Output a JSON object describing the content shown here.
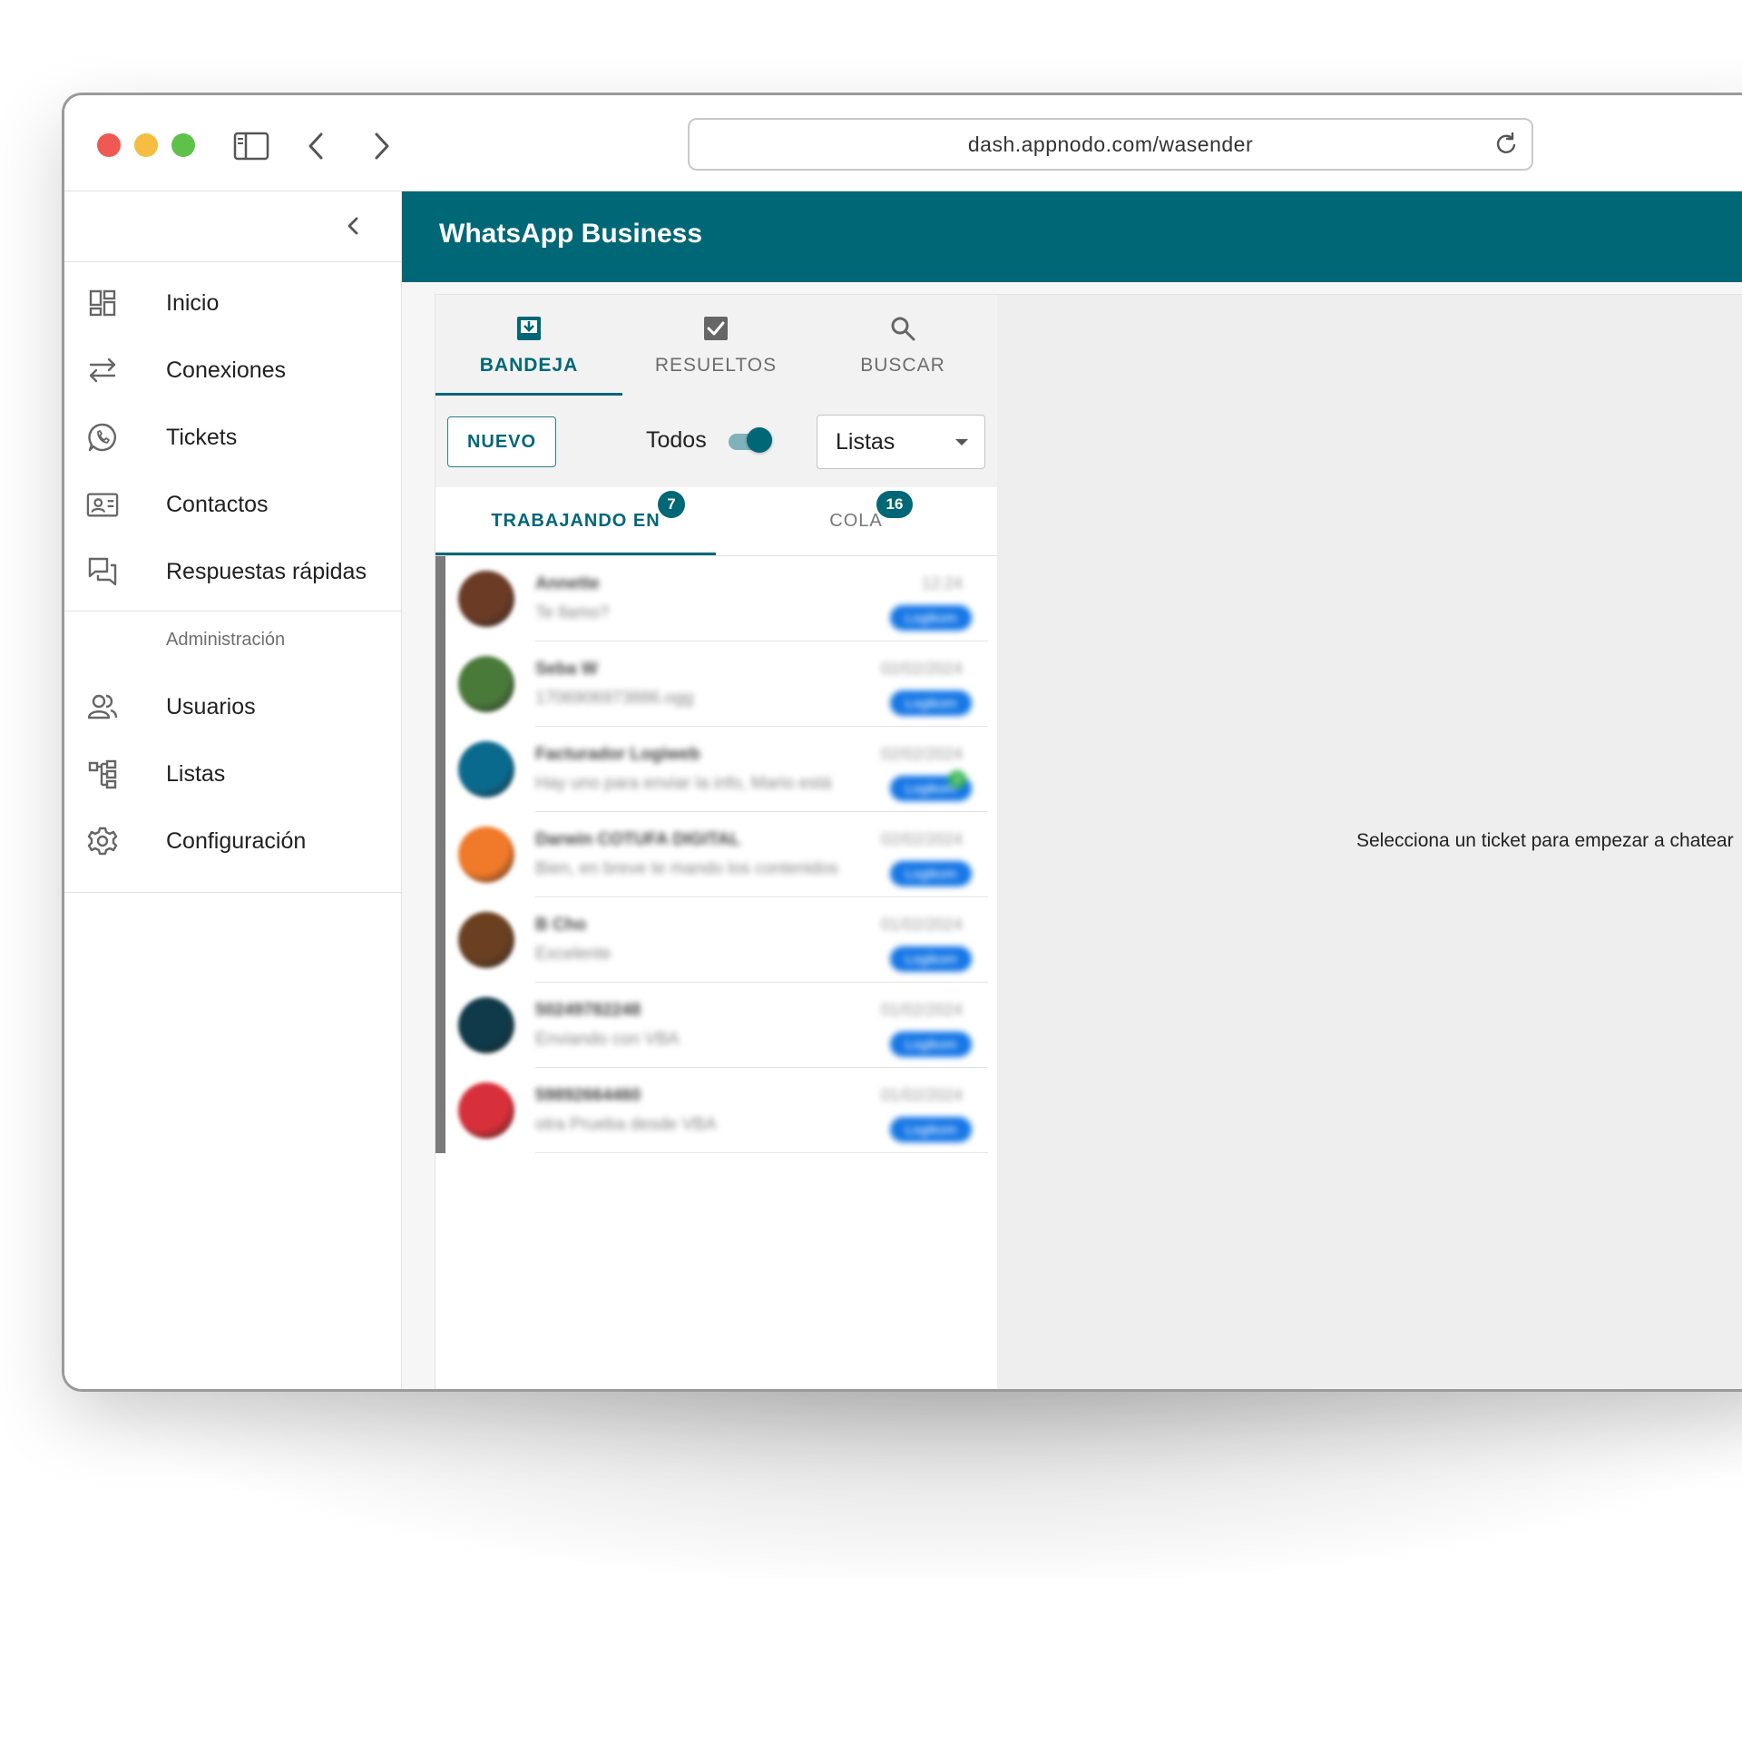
{
  "browser": {
    "url": "dash.appnodo.com/wasender",
    "icons": [
      "sidebar-toggle-icon",
      "back-arrow-icon",
      "forward-arrow-icon",
      "reload-icon"
    ]
  },
  "app": {
    "title": "WhatsApp Business",
    "accent_color": "#006776"
  },
  "sidebar": {
    "items": [
      {
        "label": "Inicio",
        "icon": "dashboard-icon"
      },
      {
        "label": "Conexiones",
        "icon": "swap-arrows-icon"
      },
      {
        "label": "Tickets",
        "icon": "whatsapp-icon"
      },
      {
        "label": "Contactos",
        "icon": "contact-card-icon"
      },
      {
        "label": "Respuestas rápidas",
        "icon": "chat-bubbles-icon"
      }
    ],
    "admin_header": "Administración",
    "admin_items": [
      {
        "label": "Usuarios",
        "icon": "users-icon"
      },
      {
        "label": "Listas",
        "icon": "tree-structure-icon"
      },
      {
        "label": "Configuración",
        "icon": "gear-icon"
      }
    ]
  },
  "tickets": {
    "tabs": [
      {
        "label": "BANDEJA",
        "icon": "inbox-icon",
        "active": true
      },
      {
        "label": "RESUELTOS",
        "icon": "check-box-icon",
        "active": false
      },
      {
        "label": "BUSCAR",
        "icon": "search-icon",
        "active": false
      }
    ],
    "new_button": "NUEVO",
    "toggle_label": "Todos",
    "toggle_on": true,
    "queue_select": "Listas",
    "subtabs": [
      {
        "label": "TRABAJANDO EN",
        "badge": "7",
        "active": true
      },
      {
        "label": "COLA",
        "badge": "16",
        "active": false
      }
    ],
    "list": [
      {
        "name": "Annette",
        "message": "Te llamo?",
        "date": "12:24",
        "tag": "Logikom",
        "avatar_color": "#6b3b26"
      },
      {
        "name": "Seba W",
        "message": "1706906973886.ogg",
        "date": "02/02/2024",
        "tag": "Logikom",
        "avatar_color": "#4a7a3a"
      },
      {
        "name": "Facturador Logiweb",
        "message": "Hay uno para enviar la info, Mario está",
        "date": "02/02/2024",
        "tag": "Logikom",
        "unread": "3",
        "avatar_color": "#0a6a8e"
      },
      {
        "name": "Darwin COTUFA DIGITAL",
        "message": "Bien, en breve te mando los contenidos",
        "date": "02/02/2024",
        "tag": "Logikom",
        "avatar_color": "#f07a2a"
      },
      {
        "name": "B Cho",
        "message": "Excelente",
        "date": "01/02/2024",
        "tag": "Logikom",
        "avatar_color": "#6a4020"
      },
      {
        "name": "50249782248",
        "message": "Enviando con VBA",
        "date": "01/02/2024",
        "tag": "Logikom",
        "avatar_color": "#0f3a4a"
      },
      {
        "name": "59892664460",
        "message": "otra Prueba desde VBA",
        "date": "01/02/2024",
        "tag": "Logikom",
        "avatar_color": "#d8303a"
      }
    ]
  },
  "empty_state": "Selecciona un ticket para empezar a chatear"
}
